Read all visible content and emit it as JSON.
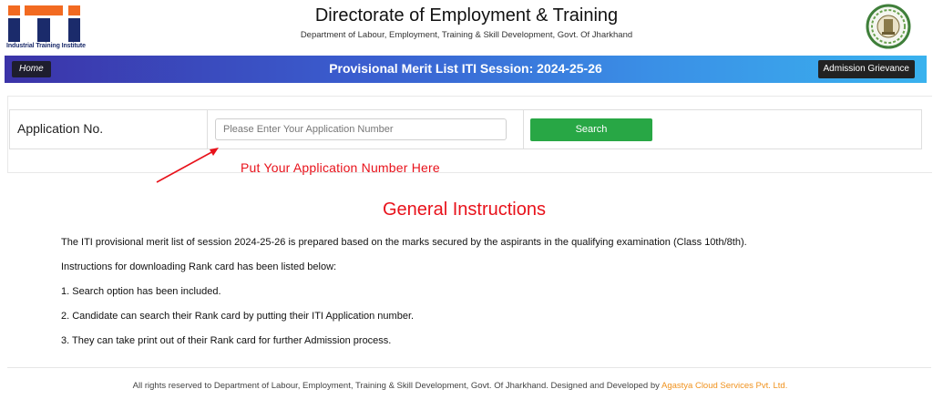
{
  "header": {
    "logo_text": "iti",
    "logo_caption": "Industrial Training Institute",
    "title": "Directorate of Employment & Training",
    "subtitle": "Department of Labour, Employment, Training & Skill Development, Govt. Of Jharkhand",
    "emblem_icon": "jharkhand-state-emblem"
  },
  "navbar": {
    "home_label": "Home",
    "title": "Provisional Merit List ITI Session: 2024-25-26",
    "grievance_label": "Admission Grievance"
  },
  "search": {
    "label": "Application No.",
    "input_value": "",
    "placeholder": "Please Enter Your Application Number",
    "button_label": "Search",
    "hint": "Put Your Application Number Here"
  },
  "instructions": {
    "title": "General Instructions",
    "lines": [
      "The ITI provisional merit list of session 2024-25-26 is prepared based on the marks secured by the aspirants in the qualifying examination (Class 10th/8th).",
      "Instructions for downloading Rank card has been listed below:",
      "1. Search option has been included.",
      "2. Candidate can search their Rank card by putting their ITI Application number.",
      "3. They can take print out of their Rank card for further Admission process."
    ]
  },
  "footer": {
    "text": "All rights reserved to Department of Labour, Employment, Training & Skill Development, Govt. Of Jharkhand. Designed and Developed by",
    "developer": "Agastya Cloud Services Pvt. Ltd."
  },
  "colors": {
    "accent_red": "#e8121b",
    "search_green": "#28a745",
    "nav_gradient_start": "#3b33a8",
    "nav_gradient_end": "#39b2ee",
    "logo_orange": "#f26a21",
    "logo_navy": "#1b2b6b",
    "footer_brand": "#f0921e"
  }
}
